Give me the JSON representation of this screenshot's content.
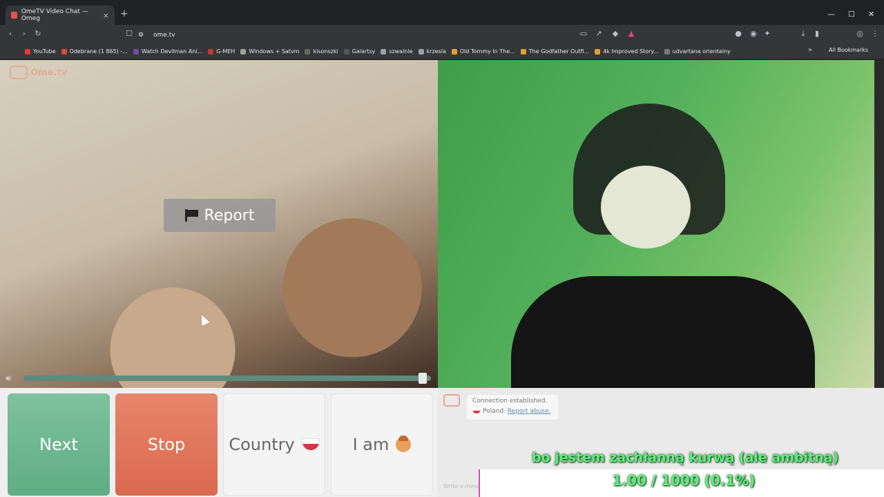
{
  "browser": {
    "tab_title": "OmeTV Video Chat — Omeg",
    "tab_close": "×",
    "new_tab": "+",
    "url": "ome.tv",
    "bookmarks": [
      {
        "label": "YouTube",
        "color": "#e53935"
      },
      {
        "label": "Odebrane (1 865) -...",
        "color": "#d14c3a"
      },
      {
        "label": "Watch Devilman Ani...",
        "color": "#6b4fa0"
      },
      {
        "label": "G-MEH",
        "color": "#c0392b"
      },
      {
        "label": "Windows + Satvm",
        "color": "#9e9e9e"
      },
      {
        "label": "kisonszki",
        "color": "#666666"
      },
      {
        "label": "Galartsy",
        "color": "#555555"
      },
      {
        "label": "szwalnie",
        "color": "#9aa0a6"
      },
      {
        "label": "krzesla",
        "color": "#9aa0a6"
      },
      {
        "label": "Old Tommy In The...",
        "color": "#e0a030"
      },
      {
        "label": "The Godfather Outfi...",
        "color": "#e0a030"
      },
      {
        "label": "4k Improved Story...",
        "color": "#e0a030"
      },
      {
        "label": "udvartana orientalny",
        "color": "#777777"
      }
    ],
    "all_bookmarks": "All Bookmarks"
  },
  "app": {
    "logo_text": "Ome.tv",
    "report_label": "Report"
  },
  "controls": {
    "next_label": "Next",
    "stop_label": "Stop",
    "country_label": "Country",
    "iam_label": "I am",
    "volume_level": 0.98
  },
  "chat": {
    "connection_msg": "Connection established.",
    "country_text": "Poland.",
    "report_abuse": "Report abuse.",
    "input_placeholder": "Write a message"
  },
  "overlay": {
    "subtitle": "bo jestem zachłanną kurwą (ale ambitną)",
    "counter": "1.00 / 1000 (0.1%)"
  }
}
